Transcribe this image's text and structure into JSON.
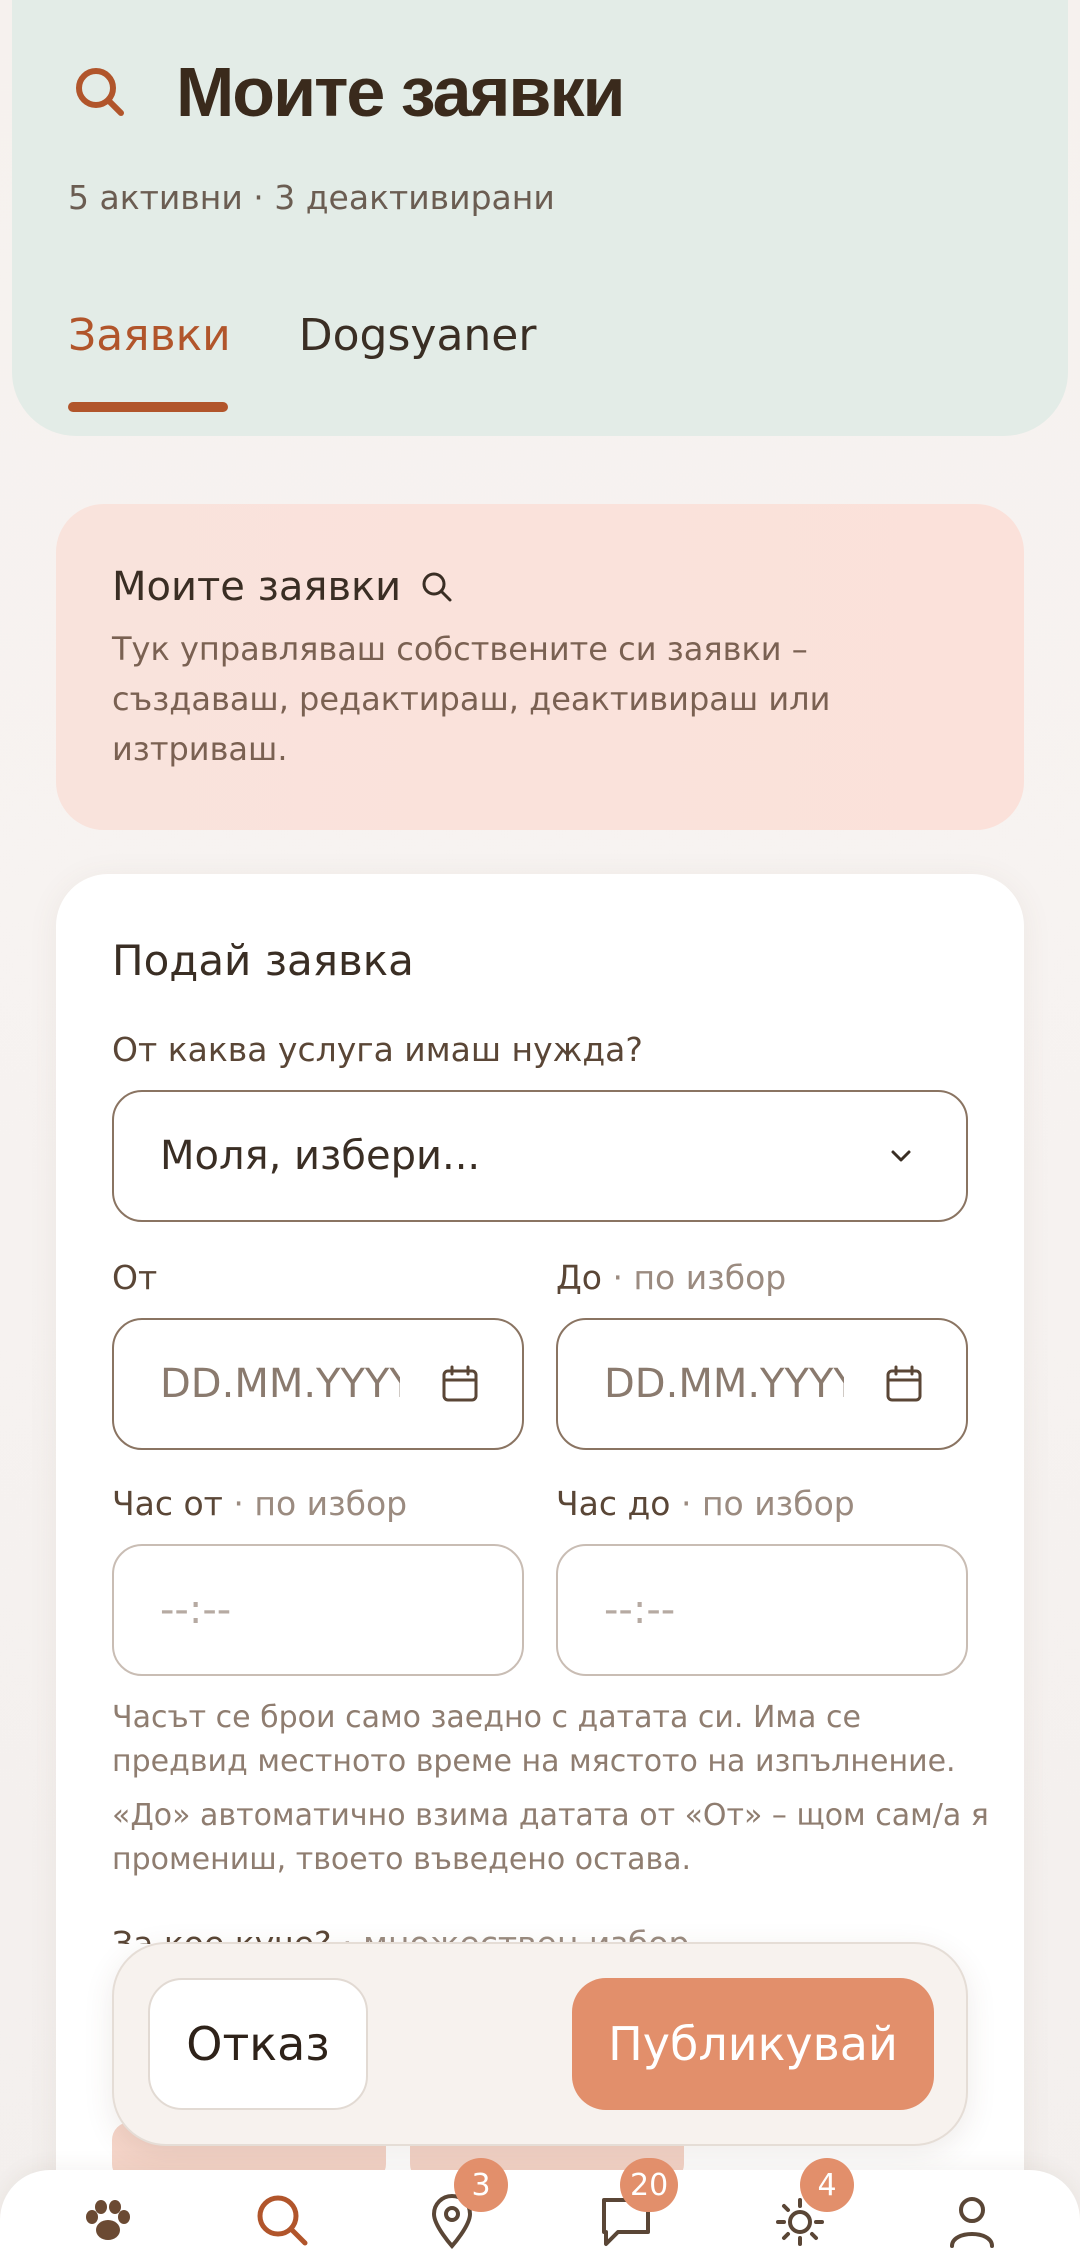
{
  "header": {
    "title": "Моите заявки",
    "subtitle": "5 активни · 3 деактивирани",
    "tabs": [
      {
        "label": "Заявки",
        "active": true
      },
      {
        "label": "Dogsyaner",
        "active": false
      }
    ]
  },
  "info_card": {
    "title": "Моите заявки",
    "text": "Тук управляваш собствените си заявки – създаваш, редактираш, деактивираш или изтриваш."
  },
  "form": {
    "title": "Подай заявка",
    "service_label": "От каква услуга имаш нужда?",
    "service_value": "Моля, избери...",
    "from_label": "От",
    "to_label": "До",
    "optional": "· по избор",
    "date_placeholder": "DD.MM.YYYY",
    "time_from_label": "Час от",
    "time_to_label": "Час до",
    "time_placeholder": "--:--",
    "help_1": "Часът се брои само заедно с датата си. Има се предвид местното време на мястото на изпълнение.",
    "help_2": "«До» автоматично взима датата от «От» – щом сам/а я промениш, твоето въведено остава.",
    "dog_label": "За кое куче?",
    "dog_label_hint": "· множествен избор"
  },
  "actions": {
    "cancel": "Отказ",
    "publish": "Публикувай"
  },
  "bottom_nav": {
    "items": [
      {
        "icon": "paw-icon",
        "badge": null
      },
      {
        "icon": "search-icon",
        "badge": null
      },
      {
        "icon": "map-pin-icon",
        "badge": "3"
      },
      {
        "icon": "chat-icon",
        "badge": "20"
      },
      {
        "icon": "sun-icon",
        "badge": "4"
      },
      {
        "icon": "profile-icon",
        "badge": null
      }
    ]
  },
  "colors": {
    "accent": "#b1552b",
    "button": "#e28f6b",
    "header_bg": "#e3ece7",
    "info_bg": "#f9e3dc"
  }
}
